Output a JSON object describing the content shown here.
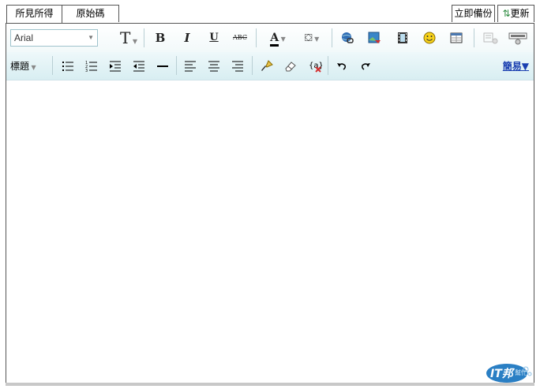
{
  "tabs": {
    "wysiwyg": "所見所得",
    "source": "原始碼",
    "backup": "立即備份",
    "update": "更新"
  },
  "toolbar": {
    "font_family": "Arial",
    "text_size_glyph": "T",
    "bold_glyph": "B",
    "italic_glyph": "I",
    "underline_glyph": "U",
    "strike_glyph": "ABC",
    "text_color_glyph": "A",
    "format_label": "標題",
    "mode_link": "簡易▼"
  },
  "logo": {
    "text": "IT邦",
    "subtext": "幫忙"
  },
  "colors": {
    "toolbar_top": "#f2f9fa",
    "toolbar_bottom": "#d8eef2",
    "link": "#1a3fb0",
    "logo": "#2a7fc4"
  }
}
